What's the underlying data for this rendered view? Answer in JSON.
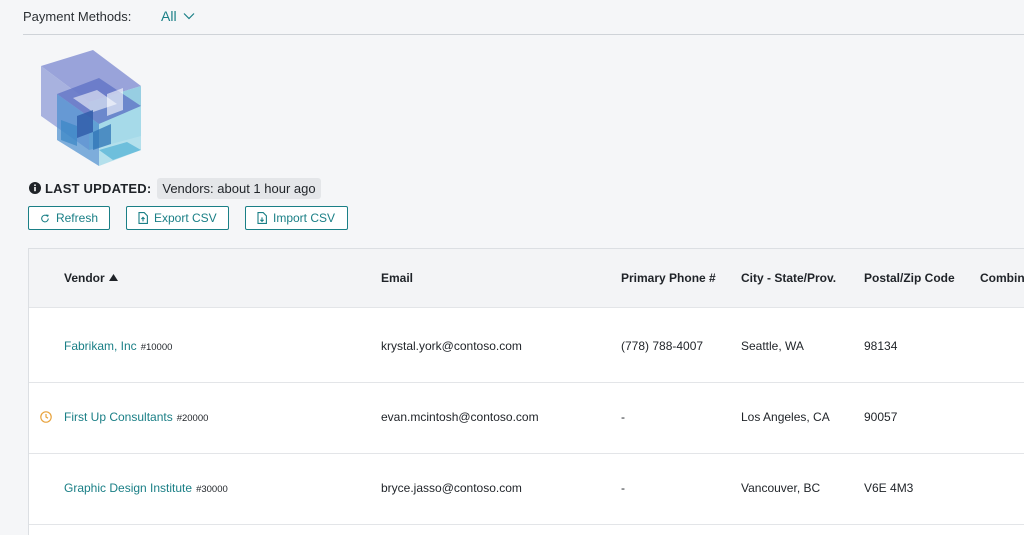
{
  "filter": {
    "label": "Payment Methods:",
    "value": "All"
  },
  "last_updated": {
    "label": "LAST UPDATED:",
    "value": "Vendors: about 1 hour ago"
  },
  "buttons": {
    "refresh": "Refresh",
    "export": "Export CSV",
    "import": "Import CSV"
  },
  "table": {
    "columns": [
      "Vendor",
      "Email",
      "Primary Phone #",
      "City - State/Prov.",
      "Postal/Zip Code",
      "Combin"
    ],
    "rows": [
      {
        "vendor": "Fabrikam, Inc",
        "number": "#10000",
        "email": "krystal.york@contoso.com",
        "phone": "(778) 788-4007",
        "city": "Seattle, WA",
        "postal": "98134",
        "status_icon": ""
      },
      {
        "vendor": "First Up Consultants",
        "number": "#20000",
        "email": "evan.mcintosh@contoso.com",
        "phone": "-",
        "city": "Los Angeles, CA",
        "postal": "90057",
        "status_icon": "clock-icon"
      },
      {
        "vendor": "Graphic Design Institute",
        "number": "#30000",
        "email": "bryce.jasso@contoso.com",
        "phone": "-",
        "city": "Vancouver, BC",
        "postal": "V6E 4M3",
        "status_icon": ""
      }
    ]
  },
  "colors": {
    "accent": "#1a7f86",
    "warning": "#e8a33d",
    "background": "#f5f6f8"
  }
}
